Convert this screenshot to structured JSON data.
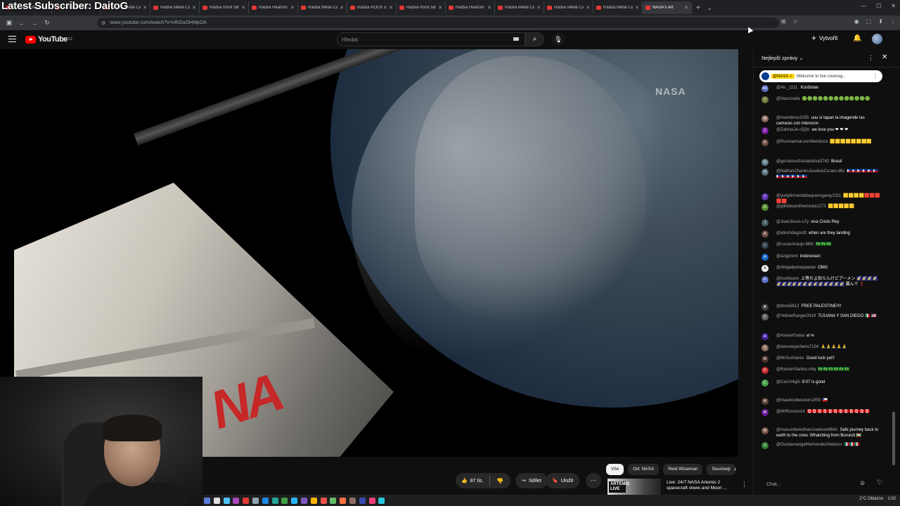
{
  "overlay": {
    "text": "Latest Subscriber: DaitoG"
  },
  "tabs": [
    {
      "title": "Radxa Metal Ca",
      "color": "#e53935"
    },
    {
      "title": "Radxa Metal Ca",
      "color": "#e53935"
    },
    {
      "title": "Radxa Metal Ca",
      "color": "#e53935"
    },
    {
      "title": "Radxa Metal Ca",
      "color": "#e53935"
    },
    {
      "title": "Radxa Rock 5B",
      "color": "#e53935"
    },
    {
      "title": "Radxa Heatsini",
      "color": "#e53935"
    },
    {
      "title": "Radxa Metal Ca",
      "color": "#e53935"
    },
    {
      "title": "Radxa ROCK 5B",
      "color": "#e53935"
    },
    {
      "title": "Radxa Rock 5B",
      "color": "#e53935"
    },
    {
      "title": "Radxa Heatsini",
      "color": "#e53935"
    },
    {
      "title": "Radxa Metal Ca",
      "color": "#e53935"
    },
    {
      "title": "Radxa Metal Ca",
      "color": "#e53935"
    },
    {
      "title": "Radxa Metal Ca",
      "color": "#e53935"
    },
    {
      "title": "NASA's Art",
      "color": "#e53935"
    }
  ],
  "address": {
    "url": "www.youtube.com/watch?v=nfhDuOHMpOA"
  },
  "youtube": {
    "logo_text": "YouTube",
    "logo_sup": "CZ",
    "search_placeholder": "Hledat",
    "create_label": "Vytvořit"
  },
  "video": {
    "watermark": "NASA",
    "nasa_logo": "NA"
  },
  "actions": {
    "likes": "87 tis.",
    "share": "Sdílet",
    "save": "Uložit"
  },
  "chips": [
    "Vše",
    "Od: NASA",
    "Reid Wiseman",
    "Souvisejí"
  ],
  "recommendation": {
    "thumb_label": "ARTEMIS LIVE",
    "title": "Live: 24/7 NASA Artemis 2 spacecraft views and Moon ..."
  },
  "chat": {
    "title": "Nejlepší zprávy",
    "pinned_author": "@NASA ✓",
    "pinned_text": "Welcome to live coverag...",
    "input_placeholder": "Chat...",
    "messages": [
      {
        "author": "@Ak._1111.",
        "text": "Kurdistan",
        "color": "#5c6bc0",
        "initial": "AK"
      },
      {
        "author": "@Vascoseta",
        "text": "🟢🟢🟢🟢🟢🟢🟢🟢🟢🟢🟢🟢🟢",
        "color": "#6d7a3a",
        "initial": "V"
      },
      {
        "author": "@mariobrou1035",
        "text": "uuu si tapan la imagende las camaras con intencion",
        "color": "#8d6e63",
        "initial": "M"
      },
      {
        "author": "@ZahrasJe-c5j3o",
        "text": "we love you ❤ ❤ ❤",
        "color": "#7b1fa2",
        "initial": "Z"
      },
      {
        "author": "@RusmarinaLeonMendoza",
        "text": "🟨🟨🟨🟨🟨🟨🟨🟨",
        "color": "#6d4c41",
        "initial": "R"
      },
      {
        "author": "@geciarsexfrasiadsilva3762",
        "text": "Brasil",
        "color": "#607d8b",
        "initial": "G"
      },
      {
        "author": "@NathanCharlesJoseluisCuram-d6z",
        "text": "🇵🇭🇵🇭🇵🇭🇵🇭🇵🇭🇵🇭🇵🇭🇵🇭🇵🇭🇵🇭🇵🇭🇵🇭",
        "color": "#546e7a",
        "initial": "N"
      },
      {
        "author": "@yudyfernandabaquerogaray1311",
        "text": "🟨🟨🟨🟨🟥🟥🟥🟥🟥",
        "color": "#5e35b1",
        "initial": "Y"
      },
      {
        "author": "@giliolacarolinezerpa1273",
        "text": "🟨🟨🟨🟨🟨",
        "color": "#558b2f",
        "initial": "G"
      },
      {
        "author": "@JuanJesus-s7y",
        "text": "viva Cristo Rey",
        "color": "#455a64",
        "initial": "J"
      },
      {
        "author": "@alinshdagosttt",
        "text": "when are they landing",
        "color": "#6d4c41",
        "initial": "A"
      },
      {
        "author": "@LucasAraujo-86th",
        "text": "🇧🇷🇧🇷🇧🇷",
        "color": "#37474f",
        "initial": "L"
      },
      {
        "author": "@a2qprwnt",
        "text": "indonesian",
        "color": "#1565c0",
        "initial": "A"
      },
      {
        "author": "@Abigailpereppadan",
        "text": "OMG",
        "color": "#eeeeee",
        "initial": "A"
      },
      {
        "author": "@hoshisere",
        "text": "上等だよ知らんけどアーメン 🌠🌠🌠🌠🌠🌠🌠🌠🌠🌠🌠🌠🌠🌠🌠🌠🌠 翼んで ❗",
        "color": "#5c6bc0",
        "initial": "H"
      },
      {
        "author": "@drew5812",
        "text": "FREE PALESTINE!!!!",
        "color": "#424242",
        "initial": "★"
      },
      {
        "author": "@YellowRanger2619",
        "text": "TIJUANA Y SAN DIEGO 🇲🇽 🇺🇸",
        "color": "#616161",
        "initial": "Y"
      },
      {
        "author": "@AsenetYama",
        "text": "אי'ש",
        "color": "#4527a0",
        "initial": "A"
      },
      {
        "author": "@simonepinheiro7154",
        "text": "🙏🙏🙏🙏🙏",
        "color": "#8d6e63",
        "initial": "S"
      },
      {
        "author": "@MrSuchanec",
        "text": "Good luck ya!!!",
        "color": "#4e342e",
        "initial": "M"
      },
      {
        "author": "@RamonSantos-n4q",
        "text": "🇧🇷🇧🇷🇧🇷🇧🇷🇧🇷🇧🇷",
        "color": "#c62828",
        "initial": "R"
      },
      {
        "author": "@Carl-h4g5l",
        "text": "8:07 is good",
        "color": "#43a047",
        "initial": "C"
      },
      {
        "author": "@mauriciobesosin1059",
        "text": "🇨🇱",
        "color": "#5d4037",
        "initial": "M"
      },
      {
        "author": "@MrRusooo14",
        "text": "🇨🇦🇨🇦🇨🇦🇨🇦🇨🇦🇨🇦🇨🇦🇨🇦🇨🇦🇨🇦🇨🇦🇨🇦",
        "color": "#6a1b9a",
        "initial": "M"
      },
      {
        "author": "@masumbukotharciseelson9641",
        "text": "Safe journey back to earth to the crew. Whatching from Burundi 🇧🇮",
        "color": "#795548",
        "initial": "M"
      },
      {
        "author": "@GustavoangelHernandezVelasco",
        "text": "🇲🇽🇲🇽🇲🇽",
        "color": "#2e7d32",
        "initial": "G"
      }
    ]
  },
  "tray": {
    "weather": "2°C  Oblačno",
    "time": "1:02"
  }
}
